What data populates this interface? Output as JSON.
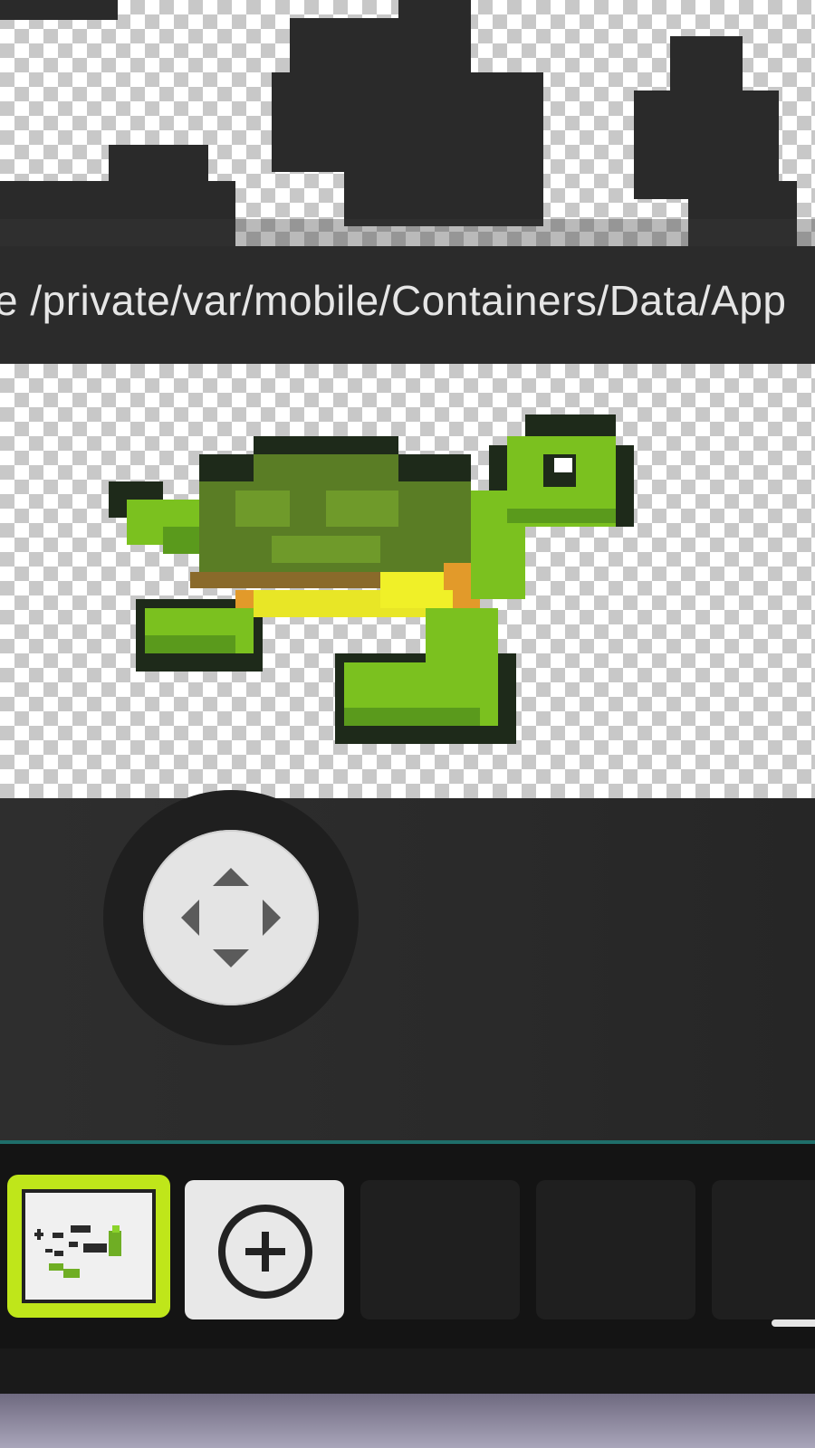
{
  "path_bar": {
    "text": "e /private/var/mobile/Containers/Data/App"
  },
  "tray": {
    "slots": [
      {
        "label": "",
        "state": "selected",
        "thumbnail": "fish-and-turtle-sprites-thumbnail"
      },
      {
        "label": "",
        "state": "add",
        "icon": "plus-circle-icon"
      },
      {
        "label": "",
        "state": "empty"
      },
      {
        "label": "",
        "state": "empty"
      },
      {
        "label": "",
        "state": "empty"
      }
    ]
  },
  "colors": {
    "selection_outline": "#bfe61a",
    "divider": "#1f6e6a",
    "turtle_shell": "#5a7d25",
    "turtle_skin": "#7bc11f",
    "turtle_belly": "#e8e626",
    "turtle_accent": "#e29a2a"
  },
  "icons": {
    "joystick": "dpad-arrows-icon",
    "add": "plus-circle-icon"
  }
}
